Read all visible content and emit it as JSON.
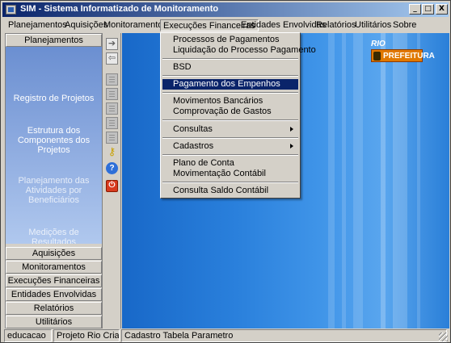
{
  "window": {
    "title": "SIM - Sistema Informatizado de Monitoramento"
  },
  "titlebar_buttons": {
    "minimize": "_",
    "maximize": "□",
    "close": "X"
  },
  "menu": [
    {
      "label": "Planejamentos"
    },
    {
      "label": "Aquisições"
    },
    {
      "label": "Monitoramentos"
    },
    {
      "label": "Execuções Financeiras",
      "active": true
    },
    {
      "label": "Entidades Envolvidas"
    },
    {
      "label": "Relatórios"
    },
    {
      "label": "Utilitários"
    },
    {
      "label": "Sobre"
    }
  ],
  "sidebar": {
    "active_group": "Planejamentos",
    "items": [
      "Registro de Projetos",
      "Estrutura dos Componentes dos Projetos",
      "Planejamento das Atividades por Beneficiários",
      "Medições de Resultados"
    ],
    "groups": [
      "Aquisições",
      "Monitoramentos",
      "Execuções Financeiras",
      "Entidades Envolvidas",
      "Relatórios",
      "Utilitários"
    ]
  },
  "toolbar": {
    "icons": [
      "arrow-right-icon",
      "arrow-left-icon",
      "document-icon",
      "document-icon",
      "document-icon",
      "document-icon",
      "document-icon",
      "key-icon",
      "help-icon",
      "power-icon"
    ],
    "help_glyph": "?",
    "power_glyph": "⏻",
    "key_glyph": "⚷",
    "arrow_right_glyph": "➔",
    "arrow_left_glyph": "⇦"
  },
  "logo": {
    "top_text": "RIO",
    "text": "PREFEITURA"
  },
  "dropdown": {
    "items": [
      {
        "label": "Processos de Pagamentos"
      },
      {
        "label": "Liquidação do Processo Pagamento"
      },
      {
        "label": "BSD"
      },
      {
        "label": "Pagamento dos Empenhos",
        "selected": true
      },
      {
        "label": "Movimentos Bancários"
      },
      {
        "label": "Comprovação de Gastos"
      },
      {
        "label": "Consultas",
        "submenu": true
      },
      {
        "label": "Cadastros",
        "submenu": true
      },
      {
        "label": "Plano de Conta"
      },
      {
        "label": "Movimentação Contábil"
      },
      {
        "label": "Consulta Saldo Contábil"
      }
    ]
  },
  "statusbar": {
    "user": "educacao",
    "project": "Projeto Rio Criança",
    "screen": "Cadastro Tabela Parametro"
  },
  "colors": {
    "titlebar_start": "#0a246a",
    "titlebar_end": "#a6caf0",
    "selection": "#0a246a",
    "workspace": "#2a80dc",
    "logo_orange": "#e07800"
  }
}
